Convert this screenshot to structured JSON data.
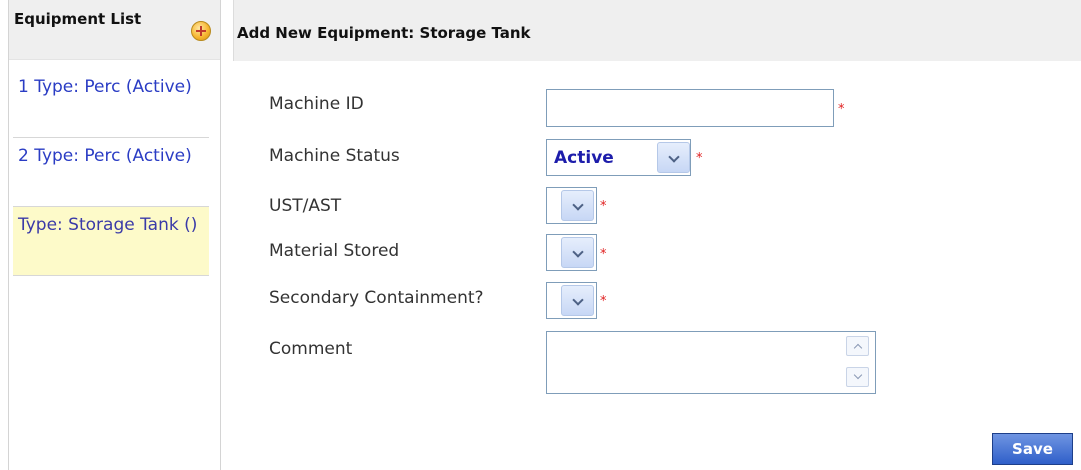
{
  "sidebar": {
    "title": "Equipment List",
    "add_icon": "plus-circle-icon",
    "items": [
      {
        "label": "1 Type: Perc (Active)"
      },
      {
        "label": "2 Type: Perc (Active)"
      },
      {
        "label": "Type: Storage Tank ()",
        "selected": true
      }
    ]
  },
  "main": {
    "title": "Add New Equipment: Storage Tank",
    "fields": {
      "machine_id": {
        "label": "Machine ID",
        "value": ""
      },
      "machine_status": {
        "label": "Machine Status",
        "value": "Active"
      },
      "ust_ast": {
        "label": "UST/AST",
        "value": ""
      },
      "material_stored": {
        "label": "Material Stored",
        "value": ""
      },
      "secondary_containment": {
        "label": "Secondary Containment?",
        "value": ""
      },
      "comment": {
        "label": "Comment",
        "value": ""
      }
    },
    "required_marker": "*",
    "save_label": "Save"
  },
  "colors": {
    "link": "#2a3cc4",
    "selected_bg": "#fdfac9",
    "header_bg": "#efefef",
    "required": "#e02020",
    "save_button": "#2f5fc9"
  }
}
